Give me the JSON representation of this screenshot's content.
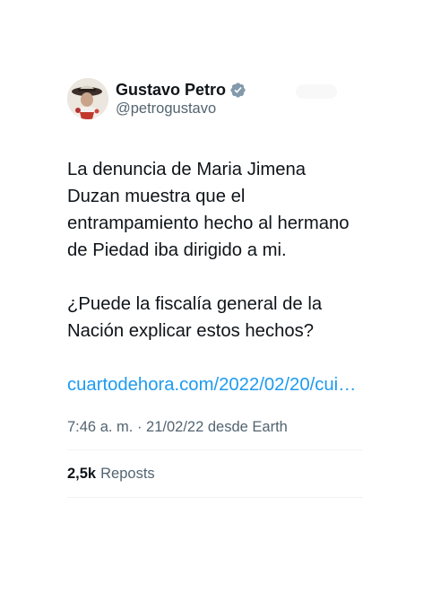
{
  "author": {
    "display_name": "Gustavo Petro",
    "handle": "@petrogustavo",
    "verified_icon": "verified-badge-icon",
    "avatar_icon": "profile-avatar"
  },
  "tweet": {
    "paragraphs": [
      "La denuncia de Maria Jimena Duzan muestra que el entrampamiento hecho al hermano de Piedad iba dirigido a mi.",
      "¿Puede la fiscalía general de la Nación explicar estos hechos?"
    ],
    "link_text": "cuartodehora.com/2022/02/20/cui…",
    "time": "7:46 a. m.",
    "separator": "·",
    "date": "21/02/22",
    "source": "desde Earth",
    "meta_text": "7:46 a. m. · 21/02/22 desde Earth"
  },
  "stats": {
    "reposts_count": "2,5k",
    "reposts_label": "Reposts"
  },
  "colors": {
    "text": "#0f1419",
    "secondary": "#536471",
    "link": "#1d9bf0",
    "verified": "#829aab",
    "divider": "#eff3f4"
  }
}
